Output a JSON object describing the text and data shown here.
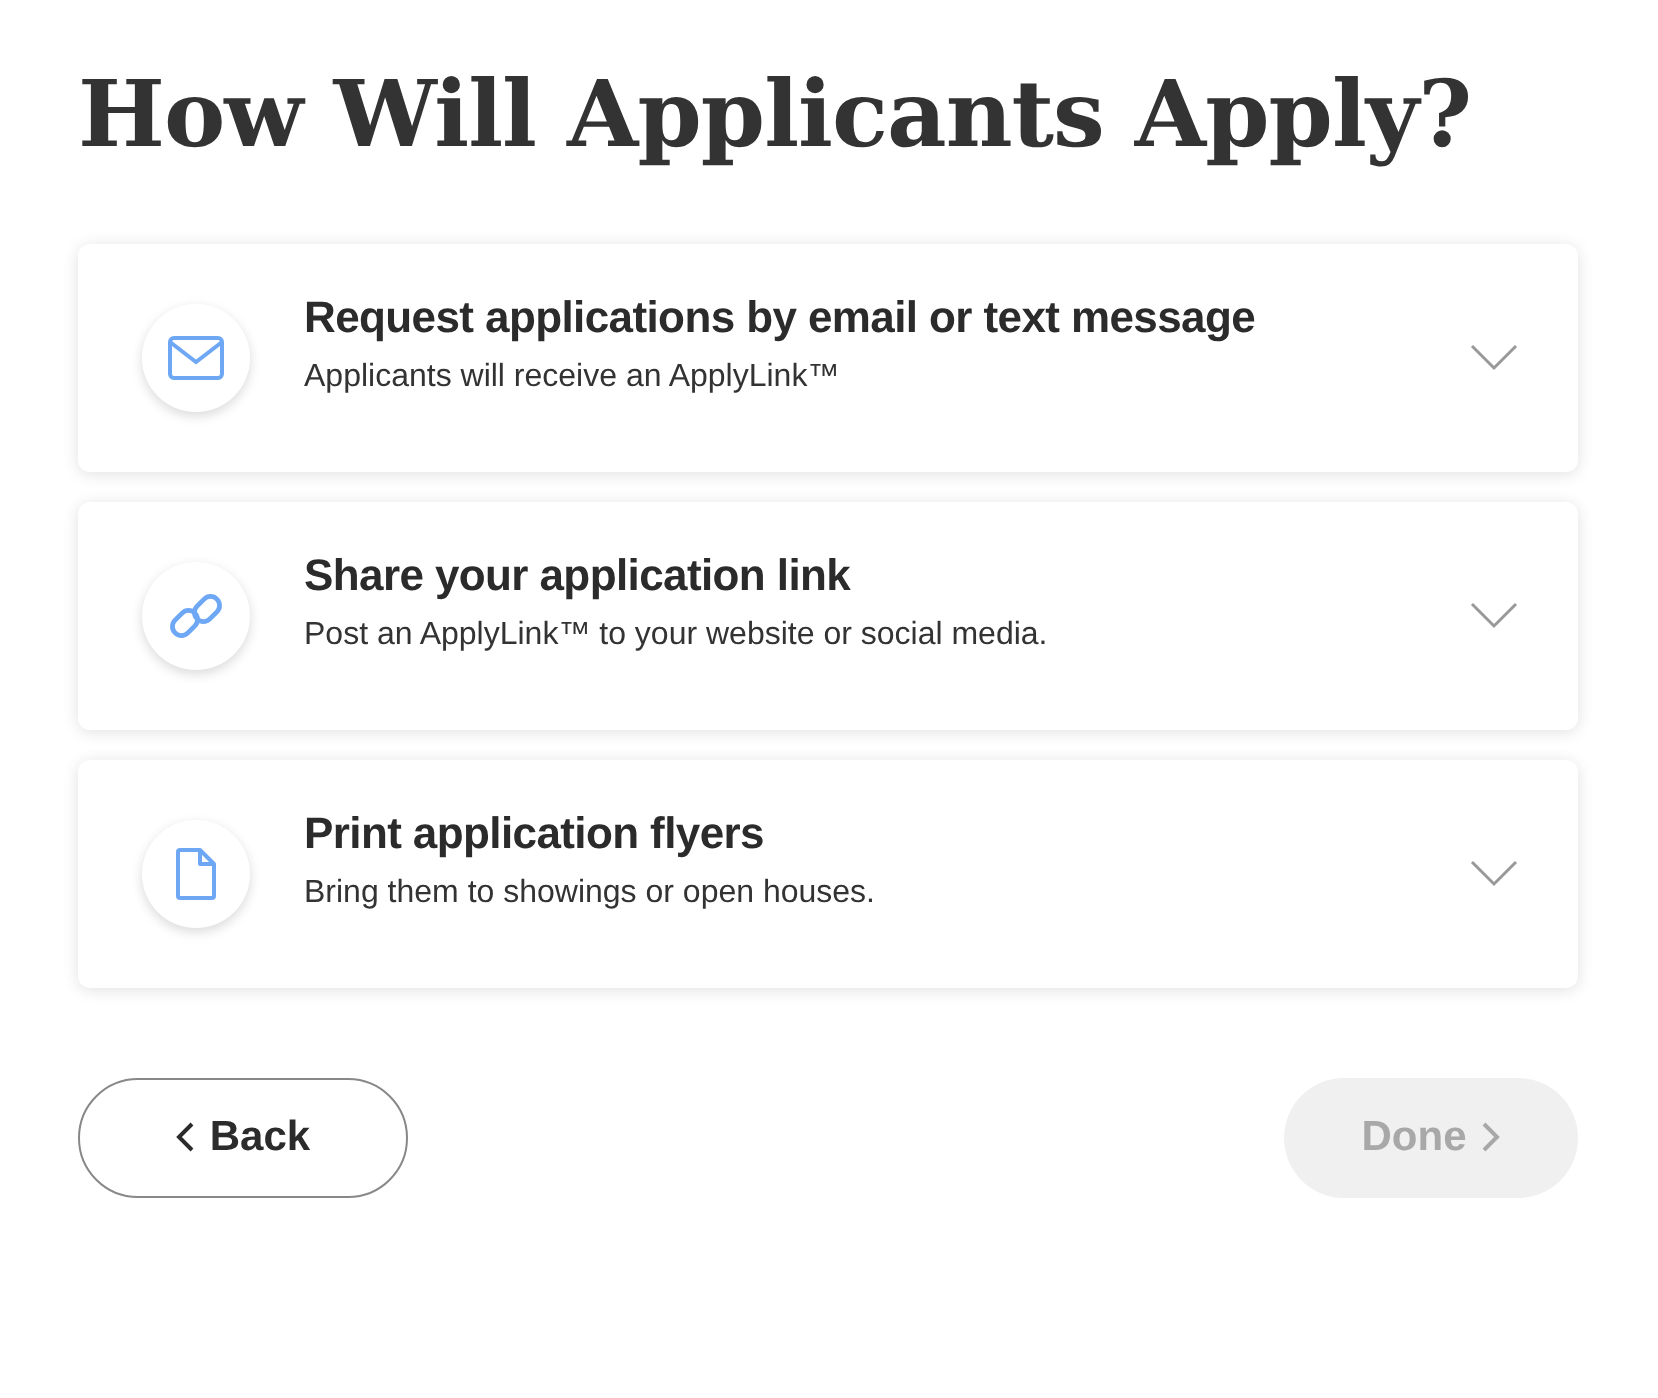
{
  "heading": "How Will Applicants Apply?",
  "options": [
    {
      "kind": "email",
      "title": "Request applications by email or text message",
      "description": "Applicants will receive an ApplyLink™",
      "expanded": false
    },
    {
      "kind": "link",
      "title": "Share your application link",
      "description": "Post an ApplyLink™ to your website or social media.",
      "expanded": false
    },
    {
      "kind": "flyer",
      "title": "Print application flyers",
      "description": "Bring them to showings or open houses.",
      "expanded": false
    }
  ],
  "back_button": {
    "label": "Back",
    "disabled": false
  },
  "done_button": {
    "label": "Done",
    "disabled": true
  }
}
